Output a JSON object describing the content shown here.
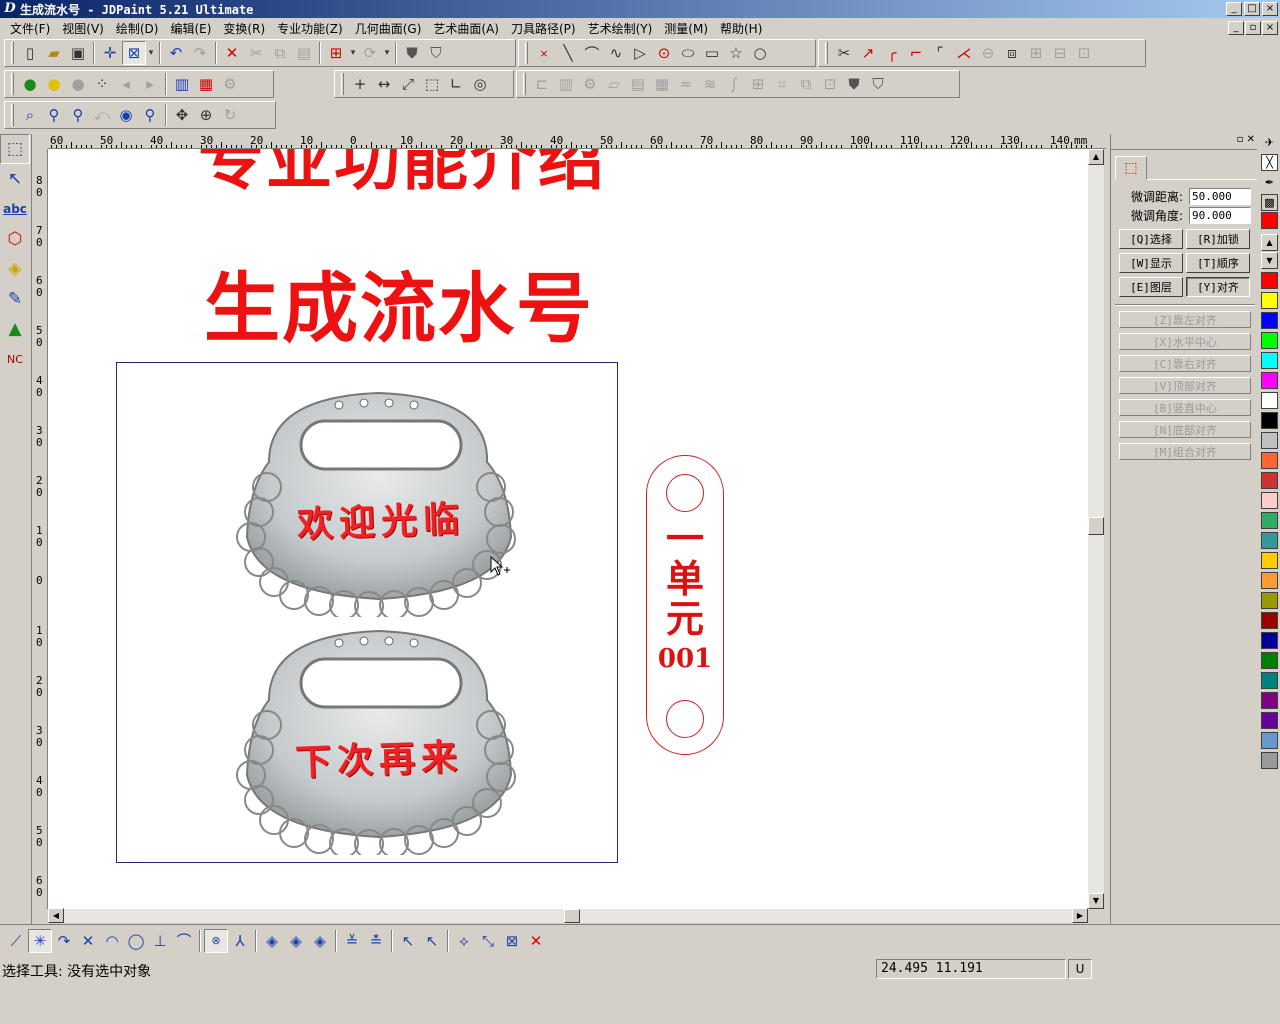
{
  "window": {
    "title": "生成流水号 - JDPaint 5.21 Ultimate",
    "app_icon": "D"
  },
  "menu": [
    "文件(F)",
    "视图(V)",
    "绘制(D)",
    "编辑(E)",
    "变换(R)",
    "专业功能(Z)",
    "几何曲面(G)",
    "艺术曲面(A)",
    "刀具路径(P)",
    "艺术绘制(Y)",
    "测量(M)",
    "帮助(H)"
  ],
  "canvas": {
    "heading_top": "专业功能介绍",
    "heading": "生成流水号",
    "tag1_text": "欢迎光临",
    "tag2_text": "下次再来",
    "label_chars": [
      "一",
      "单",
      "元"
    ],
    "label_number": "001"
  },
  "rulers": {
    "h_labels": [
      "60",
      "50",
      "40",
      "30",
      "20",
      "10",
      "0",
      "10",
      "20",
      "30",
      "40",
      "50",
      "60",
      "70",
      "80",
      "90",
      "100",
      "110",
      "120",
      "130",
      "140"
    ],
    "unit": "mm",
    "v_labels": [
      "8\n0",
      "7\n0",
      "6\n0",
      "5\n0",
      "4\n0",
      "3\n0",
      "2\n0",
      "1\n0",
      "0",
      "1\n0",
      "2\n0",
      "3\n0",
      "4\n0",
      "5\n0",
      "6\n0"
    ]
  },
  "panel": {
    "fine_distance_label": "微调距离:",
    "fine_distance_value": "50.000",
    "fine_angle_label": "微调角度:",
    "fine_angle_value": "90.000",
    "buttons": [
      "[Q]选择",
      "[R]加锁",
      "[W]显示",
      "[T]顺序",
      "[E]图层",
      "[Y]对齐"
    ],
    "align_buttons": [
      "[Z]靠左对齐",
      "[X]水平中心",
      "[C]靠右对齐",
      "[V]顶部对齐",
      "[B]竖直中心",
      "[N]底部对齐",
      "[M]组合对齐"
    ]
  },
  "palette": [
    "#ff0000",
    "#ff0000",
    "#ffff00",
    "#0000ff",
    "#00ff00",
    "#00ffff",
    "#ff00ff",
    "#ffffff",
    "#000000",
    "#c0c0c0",
    "#ff6633",
    "#cc3333",
    "#ffcccc",
    "#33aa66",
    "#339999",
    "#ffcc00",
    "#ff9933",
    "#999900",
    "#990000",
    "#000099",
    "#008000",
    "#008080",
    "#800080",
    "#660099",
    "#6699cc",
    "#999999"
  ],
  "status": {
    "message": "选择工具: 没有选中对象",
    "coords": "24.495 11.191",
    "mode": "U"
  }
}
